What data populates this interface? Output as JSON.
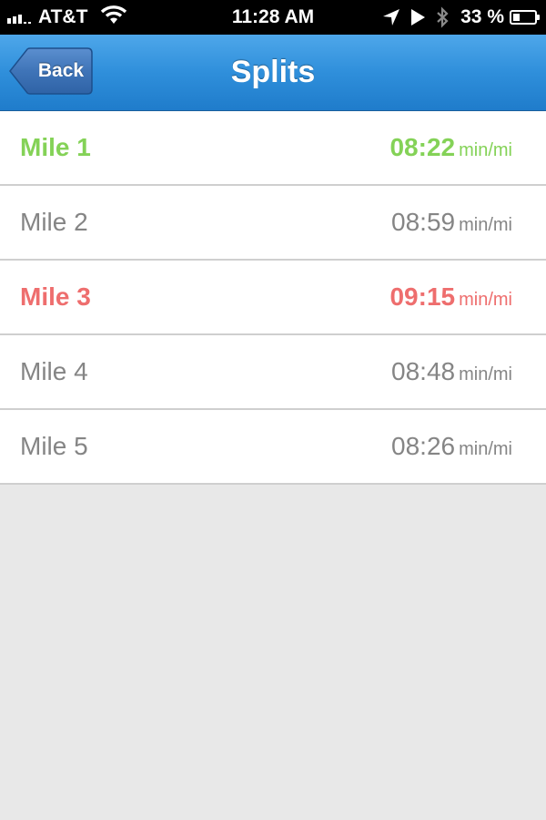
{
  "status_bar": {
    "carrier": "AT&T",
    "time": "11:28 AM",
    "battery_percent_label": "33 %",
    "battery_level": 0.33,
    "icons": [
      "signal-icon",
      "wifi-icon",
      "location-arrow-icon",
      "play-icon",
      "bluetooth-icon",
      "battery-icon"
    ]
  },
  "nav": {
    "back_label": "Back",
    "title": "Splits",
    "colors": {
      "bar": "#2f8fdb",
      "back_button": "#3c75b6"
    }
  },
  "splits": [
    {
      "label": "Mile 1",
      "pace": "08:22",
      "unit": "min/mi",
      "highlight": "fastest"
    },
    {
      "label": "Mile 2",
      "pace": "08:59",
      "unit": "min/mi",
      "highlight": "none"
    },
    {
      "label": "Mile 3",
      "pace": "09:15",
      "unit": "min/mi",
      "highlight": "slowest"
    },
    {
      "label": "Mile 4",
      "pace": "08:48",
      "unit": "min/mi",
      "highlight": "none"
    },
    {
      "label": "Mile 5",
      "pace": "08:26",
      "unit": "min/mi",
      "highlight": "none"
    }
  ],
  "colors": {
    "fastest": "#84d257",
    "slowest": "#ee6e6e",
    "normal": "#858585",
    "background": "#e8e8e8"
  }
}
